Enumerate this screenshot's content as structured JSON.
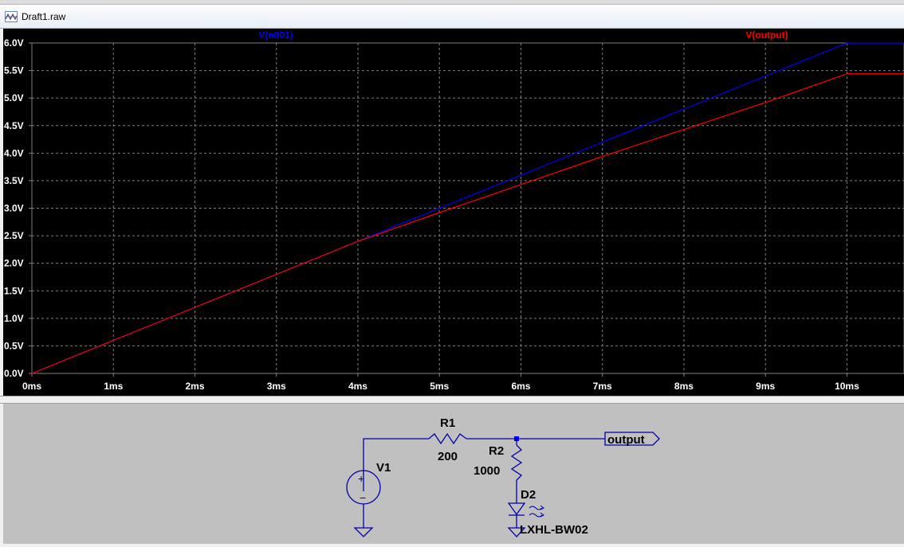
{
  "window": {
    "title": "Draft1.raw"
  },
  "colors": {
    "plot_background": "#000000",
    "grid": "#808080",
    "axis_text": "#ffffff",
    "trace_n001": "#0000ff",
    "trace_output": "#ff0000",
    "schematic_background": "#c0c0c0",
    "wire": "#0000aa",
    "label": "#000000"
  },
  "chart_data": {
    "type": "line",
    "xlabel": "",
    "ylabel": "",
    "x_ticks": [
      "0ms",
      "1ms",
      "2ms",
      "3ms",
      "4ms",
      "5ms",
      "6ms",
      "7ms",
      "8ms",
      "9ms",
      "10ms"
    ],
    "y_ticks": [
      "0.0V",
      "0.5V",
      "1.0V",
      "1.5V",
      "2.0V",
      "2.5V",
      "3.0V",
      "3.5V",
      "4.0V",
      "4.5V",
      "5.0V",
      "5.5V",
      "6.0V"
    ],
    "xlim": [
      0,
      10.7
    ],
    "ylim": [
      0,
      6.0
    ],
    "grid": true,
    "series": [
      {
        "name": "V(n001)",
        "color": "#0000ff",
        "x": [
          0,
          1,
          2,
          3,
          4,
          5,
          6,
          7,
          8,
          9,
          10,
          10.7
        ],
        "y": [
          0,
          0.6,
          1.2,
          1.8,
          2.4,
          3.0,
          3.6,
          4.2,
          4.8,
          5.4,
          6.0,
          6.0
        ]
      },
      {
        "name": "V(output)",
        "color": "#ff0000",
        "x": [
          0,
          1,
          2,
          3,
          4,
          5,
          6,
          7,
          8,
          9,
          10,
          10.7
        ],
        "y": [
          0,
          0.6,
          1.2,
          1.8,
          2.4,
          2.92,
          3.43,
          3.94,
          4.43,
          4.92,
          5.44,
          5.44
        ]
      }
    ]
  },
  "schematic": {
    "components": [
      {
        "ref": "R1",
        "value": "200"
      },
      {
        "ref": "R2",
        "value": "1000"
      },
      {
        "ref": "V1",
        "value": ""
      },
      {
        "ref": "D2",
        "value": "LXHL-BW02"
      }
    ],
    "net_label": "output"
  }
}
